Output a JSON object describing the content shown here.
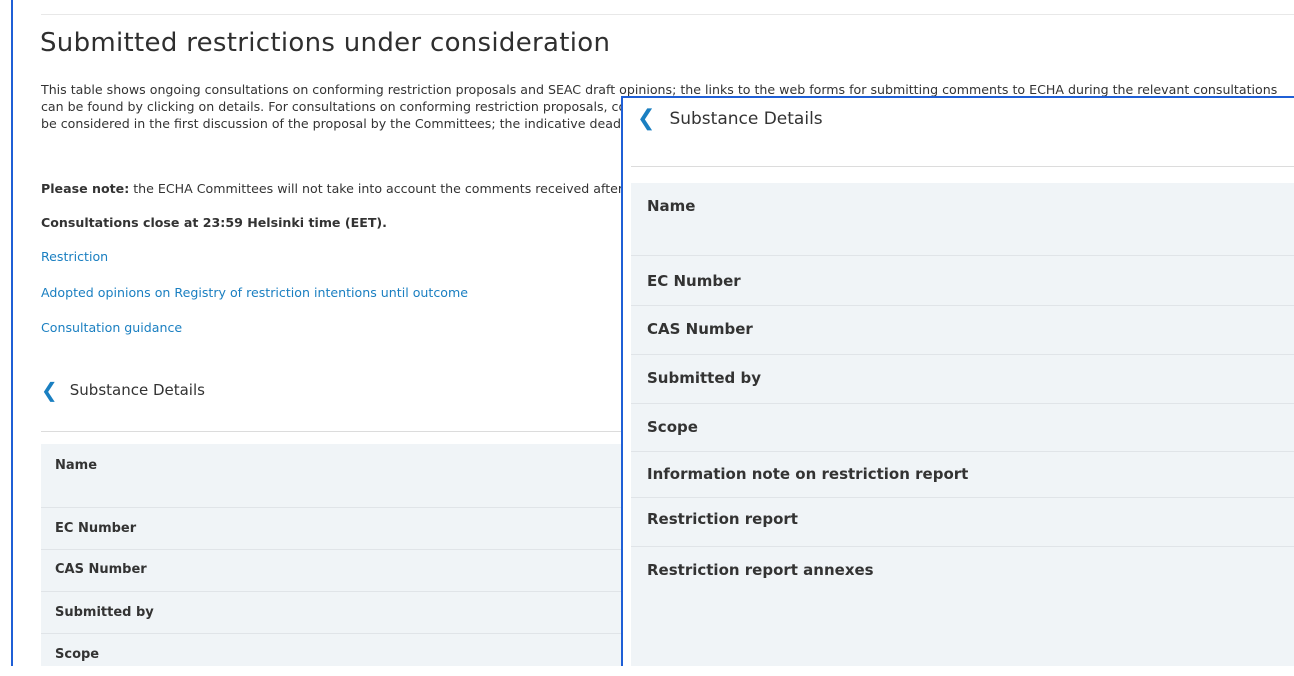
{
  "page": {
    "title": "Submitted restrictions under consideration",
    "intro": "This table shows ongoing consultations on conforming restriction proposals and SEAC draft opinions; the links to the web forms for submitting comments to ECHA during the relevant consultations can be found by clicking on details. For consultations on conforming restriction proposals, comments submitted by the indicative date before the final deadline are often very influential as they will be considered in the first discussion of the proposal by the Committees; the indicative deadline is usually around one month before the final deadline.",
    "note_bold": "Please note:",
    "note_text": " the ECHA Committees will not take into account the comments received after the final deadline.",
    "close_time": "Consultations close at 23:59 Helsinki time (EET)."
  },
  "links": {
    "restriction": "Restriction",
    "adopted_opinions": "Adopted opinions on Registry of restriction intentions until outcome",
    "consultation_guidance": "Consultation guidance"
  },
  "substance_details": {
    "header": "Substance Details",
    "back_icon": "chevron-left-icon",
    "rows": {
      "name": "Name",
      "ec_number": "EC Number",
      "cas_number": "CAS Number",
      "submitted_by": "Submitted by",
      "scope": "Scope",
      "info_note": "Information note on restriction report",
      "restriction_report": "Restriction report",
      "report_annexes": "Restriction report annexes"
    }
  },
  "colors": {
    "accent_link": "#1a7fc1",
    "highlight_border": "#1f5fd6",
    "table_bg": "#f0f4f7"
  }
}
